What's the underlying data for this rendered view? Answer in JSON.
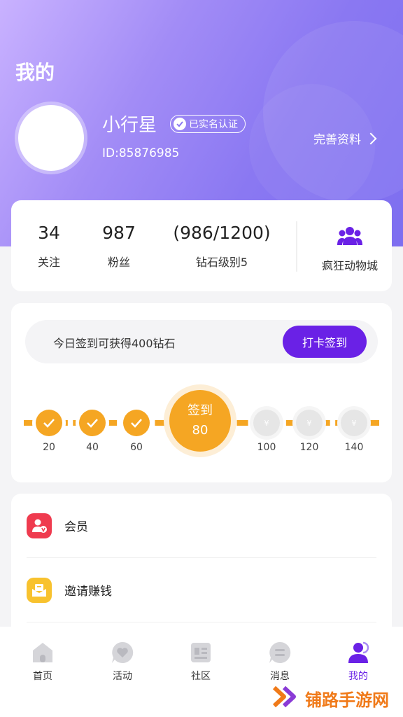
{
  "header": {
    "title": "我的",
    "username": "小行星",
    "verify_badge": "已实名认证",
    "user_id": "ID:85876985",
    "edit_profile": "完善资料"
  },
  "stats": {
    "following": {
      "value": "34",
      "label": "关注"
    },
    "followers": {
      "value": "987",
      "label": "粉丝"
    },
    "diamond": {
      "value": "(986/1200)",
      "label": "钻石级别5"
    },
    "mall": {
      "label": "疯狂动物城",
      "icon": "group-icon"
    }
  },
  "signin": {
    "hint": "今日签到可获得400钻石",
    "button": "打卡签到",
    "today_label": "签到",
    "today_value": "80",
    "days": [
      {
        "value": "20",
        "state": "done"
      },
      {
        "value": "40",
        "state": "done"
      },
      {
        "value": "60",
        "state": "done"
      },
      {
        "value": "100",
        "state": "future"
      },
      {
        "value": "120",
        "state": "future"
      },
      {
        "value": "140",
        "state": "future"
      }
    ],
    "future_symbol": "¥",
    "accent_color": "#f5a623"
  },
  "menu": {
    "items": [
      {
        "label": "会员",
        "icon": "vip-user-icon",
        "color": "#ef3b4f"
      },
      {
        "label": "邀请赚钱",
        "icon": "envelope-icon",
        "color": "#f8c22e"
      }
    ]
  },
  "tabbar": {
    "tabs": [
      {
        "label": "首页",
        "icon": "home-icon",
        "active": false
      },
      {
        "label": "活动",
        "icon": "heart-chat-icon",
        "active": false
      },
      {
        "label": "社区",
        "icon": "community-icon",
        "active": false
      },
      {
        "label": "消息",
        "icon": "message-icon",
        "active": false
      },
      {
        "label": "我的",
        "icon": "profile-icon",
        "active": true
      }
    ],
    "active_color": "#6a21e6"
  },
  "watermark": {
    "text": "铺路手游网"
  },
  "colors": {
    "brand": "#6a21e6",
    "header_start": "#c9b2ff",
    "header_end": "#7d6ef0"
  }
}
